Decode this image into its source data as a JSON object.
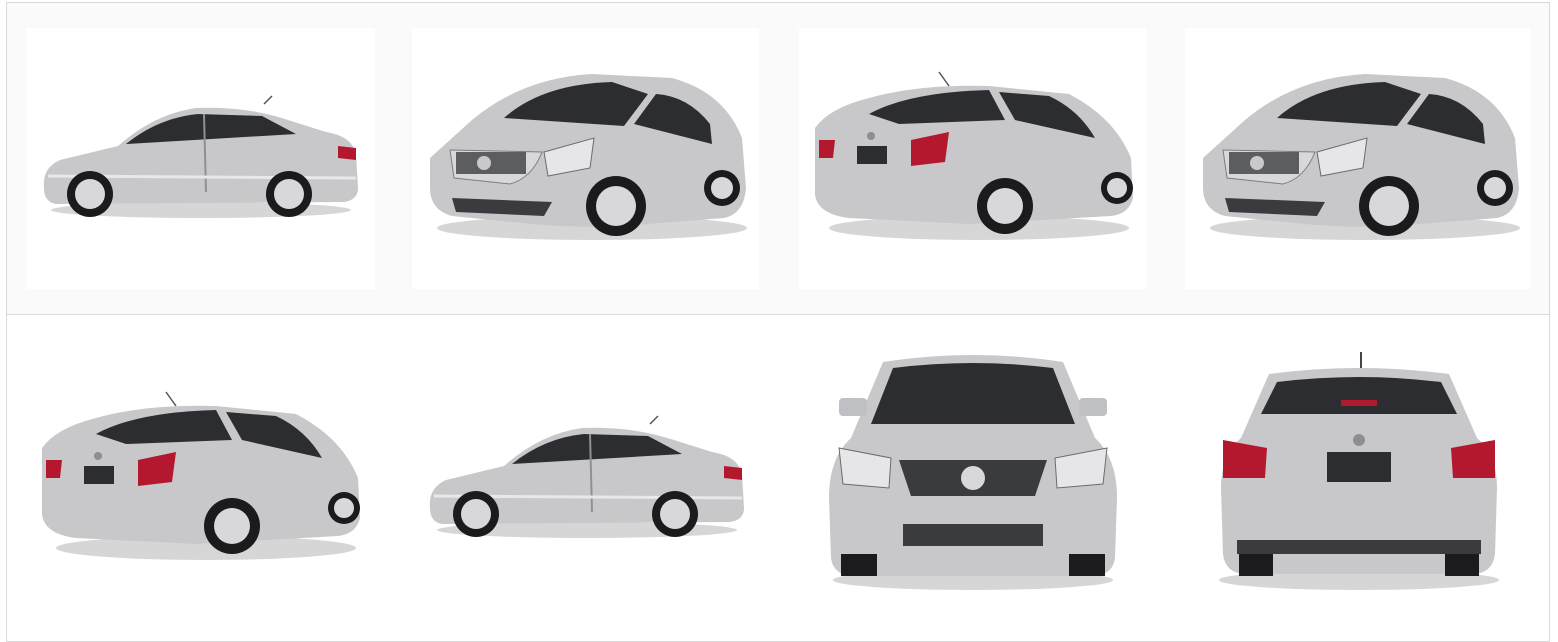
{
  "gallery": {
    "colors": {
      "body": "#c9c9cb",
      "body_light": "#e6e6e8",
      "body_dark": "#8d8e92",
      "glass": "#2b2d31",
      "tire": "#1b1b1d",
      "rim": "#d8d8da",
      "taillight": "#b3182e",
      "shadow": "#d0d0d0"
    },
    "photos": [
      {
        "view": "side-left",
        "alt_icon": "car-side-icon"
      },
      {
        "view": "front-three-quarter",
        "alt_icon": "car-front-angle-icon"
      },
      {
        "view": "rear-three-quarter",
        "alt_icon": "car-rear-angle-icon"
      },
      {
        "view": "front-three-quarter",
        "alt_icon": "car-front-angle-icon"
      },
      {
        "view": "rear-three-quarter",
        "alt_icon": "car-rear-angle-icon"
      },
      {
        "view": "side-left",
        "alt_icon": "car-side-icon"
      },
      {
        "view": "front",
        "alt_icon": "car-front-icon"
      },
      {
        "view": "rear",
        "alt_icon": "car-rear-icon"
      }
    ]
  }
}
